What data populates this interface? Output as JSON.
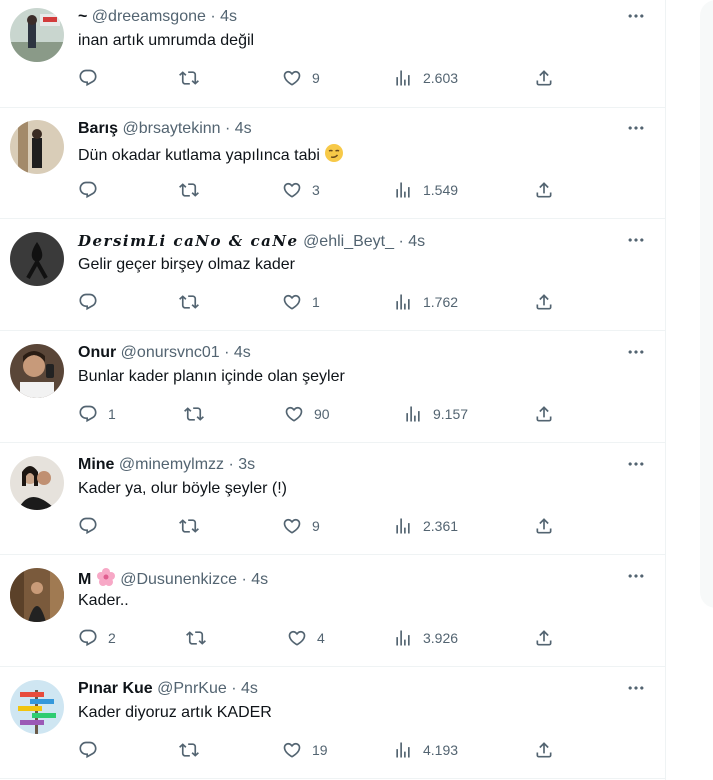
{
  "colors": {
    "text": "#0f1419",
    "muted": "#536471",
    "border": "#eff3f4"
  },
  "icons": {
    "reply": "reply-icon",
    "retweet": "retweet-icon",
    "like": "heart-icon",
    "views": "views-icon",
    "share": "share-icon",
    "more": "more-icon"
  },
  "tweets": [
    {
      "name": "~",
      "handle": "@dreeamsgone",
      "time": "4s",
      "text": "inan artık umrumda değil",
      "replies": "",
      "retweets": "",
      "likes": "9",
      "views": "2.603"
    },
    {
      "name": "Barış",
      "handle": "@brsaytekinn",
      "time": "4s",
      "text": "Dün okadar kutlama yapılınca tabi",
      "emoji": "smirk-emoji",
      "replies": "",
      "retweets": "",
      "likes": "3",
      "views": "1.549"
    },
    {
      "name": "DersimLi caNo & caNe",
      "handle": "@ehli_Beyt_",
      "time": "4s",
      "text": "Gelir geçer birşey olmaz kader",
      "replies": "",
      "retweets": "",
      "likes": "1",
      "views": "1.762"
    },
    {
      "name": "Onur",
      "handle": "@onursvnc01",
      "time": "4s",
      "text": "Bunlar kader planın içinde olan şeyler",
      "replies": "1",
      "retweets": "",
      "likes": "90",
      "views": "9.157"
    },
    {
      "name": "Mine",
      "handle": "@minemylmzz",
      "time": "3s",
      "text": "Kader ya, olur böyle şeyler (!)",
      "replies": "",
      "retweets": "",
      "likes": "9",
      "views": "2.361"
    },
    {
      "name": "M",
      "name_emoji": "cherry-blossom-emoji",
      "handle": "@Dusunenkizce",
      "time": "4s",
      "text": "Kader..",
      "replies": "2",
      "retweets": "",
      "likes": "4",
      "views": "3.926"
    },
    {
      "name": "Pınar Kue",
      "handle": "@PnrKue",
      "time": "4s",
      "text": "Kader diyoruz artık KADER",
      "replies": "",
      "retweets": "",
      "likes": "19",
      "views": "4.193"
    }
  ],
  "separator": "·"
}
